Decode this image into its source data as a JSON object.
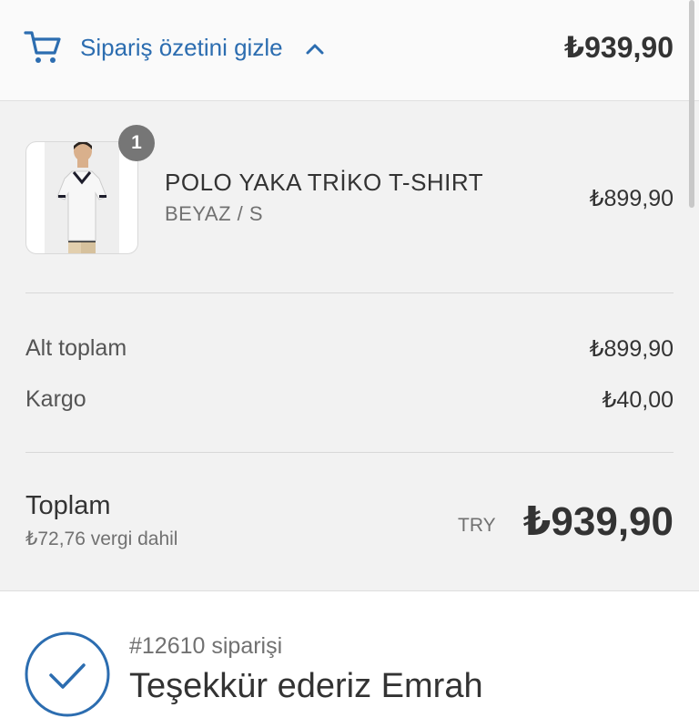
{
  "header": {
    "toggle_label": "Sipariş özetini gizle",
    "total": "₺939,90",
    "icons": {
      "cart": "cart-icon",
      "chevron": "chevron-up-icon"
    },
    "accent_color": "#2c6db0"
  },
  "line_item": {
    "quantity": "1",
    "name": "POLO YAKA TRİKO T-SHIRT",
    "variant": "BEYAZ / S",
    "price": "₺899,90"
  },
  "summary": {
    "subtotal_label": "Alt toplam",
    "subtotal_value": "₺899,90",
    "shipping_label": "Kargo",
    "shipping_value": "₺40,00",
    "total_label": "Toplam",
    "tax_note": "₺72,76 vergi dahil",
    "currency": "TRY",
    "total_value": "₺939,90"
  },
  "confirmation": {
    "order_number": "#12610 siparişi",
    "thanks": "Teşekkür ederiz Emrah",
    "icon": "check-circle-icon"
  }
}
